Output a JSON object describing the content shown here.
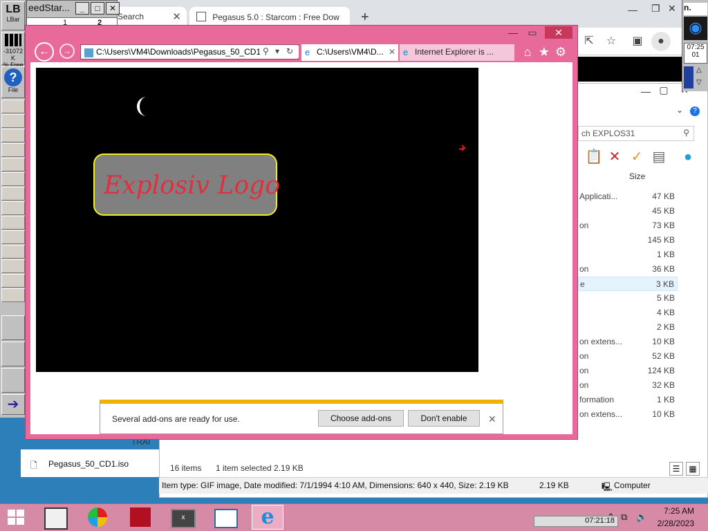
{
  "chrome": {
    "tabs": [
      {
        "label": "e Search"
      },
      {
        "label": "Pegasus 5.0 : Starcom : Free Dow"
      }
    ],
    "new_tab": "+",
    "controls": {
      "minimize": "—",
      "restore": "❐",
      "close": "✕"
    }
  },
  "speedstar": {
    "title": "eedStar...",
    "cells": [
      "1",
      "2"
    ],
    "buttons": [
      "_",
      "□",
      "✕"
    ]
  },
  "lbar": {
    "label": "LBar",
    "logo": "LB",
    "memory": "-31072 K",
    "free": "% Free",
    "file_label": "File",
    "help_glyph": "?"
  },
  "clock_widget": {
    "label": "n.",
    "time_a": "07:25",
    "time_b": "01"
  },
  "explorer": {
    "search_placeholder": "ch EXPLOS31",
    "size_header": "Size",
    "rows": [
      {
        "type": "Applicati...",
        "size": "47 KB"
      },
      {
        "type": "",
        "size": "45 KB"
      },
      {
        "type": "on",
        "size": "73 KB"
      },
      {
        "type": "",
        "size": "145 KB"
      },
      {
        "type": "",
        "size": "1 KB"
      },
      {
        "type": "on",
        "size": "36 KB"
      },
      {
        "type": "e",
        "size": "3 KB"
      },
      {
        "type": "",
        "size": "5 KB"
      },
      {
        "type": "",
        "size": "4 KB"
      },
      {
        "type": "",
        "size": "2 KB"
      },
      {
        "type": "on extens...",
        "size": "10 KB"
      },
      {
        "type": "on",
        "size": "52 KB"
      },
      {
        "type": "on",
        "size": "124 KB"
      },
      {
        "type": "on",
        "size": "32 KB"
      },
      {
        "type": "formation",
        "size": "1 KB"
      },
      {
        "type": "on extens...",
        "size": "10 KB"
      }
    ],
    "selected_index": 6,
    "status_items": "16 items",
    "status_selected": "1 item selected  2.19 KB",
    "detail": "Item type: GIF image, Date modified: 7/1/1994 4:10 AM, Dimensions: 640 x 440, Size: 2.19 KB",
    "detail_size": "2.19 KB",
    "detail_location": "Computer",
    "desktop_file": "Pegasus_50_CD1.iso",
    "desktop_trai": "TRAI"
  },
  "ie": {
    "address": "C:\\Users\\VM4\\Downloads\\Pegasus_50_CD1\\",
    "tabs": [
      {
        "label": "C:\\Users\\VM4\\D...",
        "active": true
      },
      {
        "label": "Internet Explorer is ...",
        "active": false
      }
    ],
    "logo_text": "Explosiv Logo",
    "notification": {
      "message": "Several add-ons are ready for use.",
      "choose": "Choose add-ons",
      "dont": "Don't enable",
      "close": "✕"
    }
  },
  "taskbar": {
    "clock_mini": "07:21:18",
    "time": "7:25 AM",
    "date": "2/28/2023"
  },
  "colors": {
    "ie_frame": "#e86a9a",
    "logo_text": "#e03040",
    "logo_border": "#f0f020",
    "notif_bar": "#f2b100"
  }
}
